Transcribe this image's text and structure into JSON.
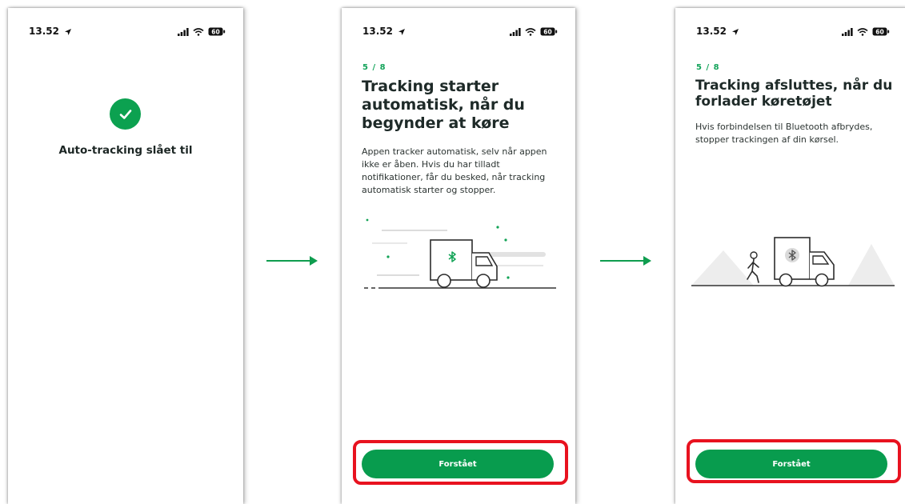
{
  "screens": [
    {
      "status": {
        "time": "13.52",
        "battery": "60"
      },
      "title": "Auto-tracking slået til"
    },
    {
      "status": {
        "time": "13.52",
        "battery": "60"
      },
      "step": "5 / 8",
      "heading": "Tracking starter automatisk, når du begynder at køre",
      "body": "Appen tracker automatisk, selv når appen ikke er åben. Hvis du har tilladt notifikationer, får du besked, når tracking automatisk starter og stopper.",
      "button": "Forstået"
    },
    {
      "status": {
        "time": "13.52",
        "battery": "60"
      },
      "step": "5 / 8",
      "heading": "Tracking afsluttes, når du forlader køretøjet",
      "body": "Hvis forbindelsen til Bluetooth afbrydes, stopper trackingen af din kørsel.",
      "button": "Forstået"
    }
  ],
  "colors": {
    "brand_green": "#089c4e",
    "step_green": "#13a35a",
    "highlight_red": "#e8121f",
    "text_dark": "#1e2a28"
  },
  "icons": [
    "location-arrow-icon",
    "signal-icon",
    "wifi-icon",
    "battery-icon",
    "checkmark-icon",
    "bluetooth-icon",
    "truck-icon",
    "walking-person-icon",
    "right-arrow-icon"
  ]
}
